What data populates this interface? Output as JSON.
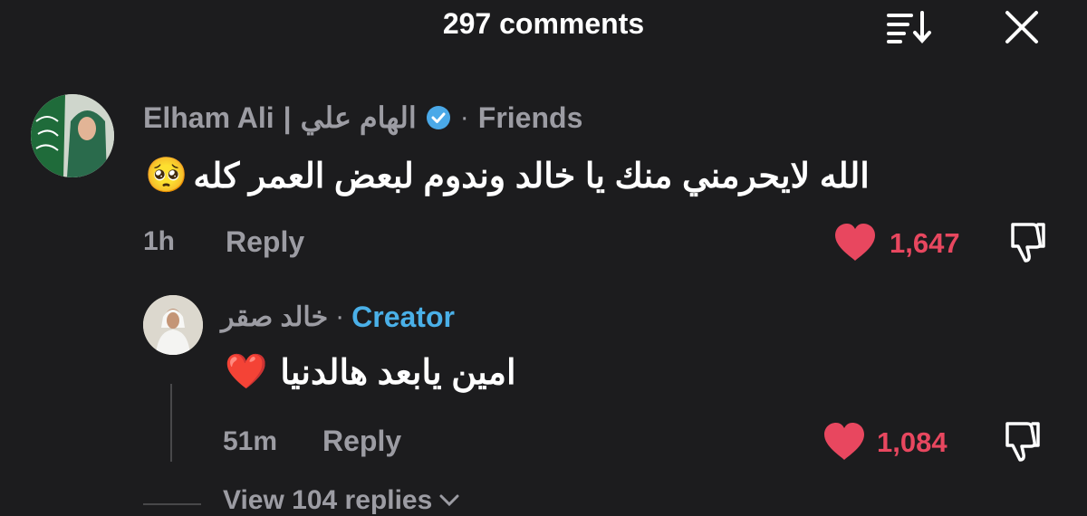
{
  "header": {
    "title": "297 comments"
  },
  "comments": [
    {
      "author_en": "Elham Ali",
      "author_sep": "|",
      "author_ar": "الهام علي",
      "tag": "Friends",
      "text": "الله لايحرمني منك يا خالد وندوم لبعض العمر كله",
      "emoji": "🥺",
      "time": "1h",
      "reply_label": "Reply",
      "likes": "1,647"
    }
  ],
  "reply": {
    "author": "خالد صقر",
    "tag": "Creator",
    "text": "امين يابعد هالدنيا",
    "emoji": "❤️",
    "time": "51m",
    "reply_label": "Reply",
    "likes": "1,084"
  },
  "view_replies": "View 104 replies",
  "colors": {
    "background": "#1c1c1e",
    "like_red": "#e8475f",
    "creator_blue": "#4ab0e8",
    "muted": "#9c9ca3"
  },
  "icons": [
    "sort-icon",
    "close-icon",
    "verified-icon",
    "heart-icon",
    "dislike-icon",
    "chevron-down-icon"
  ]
}
